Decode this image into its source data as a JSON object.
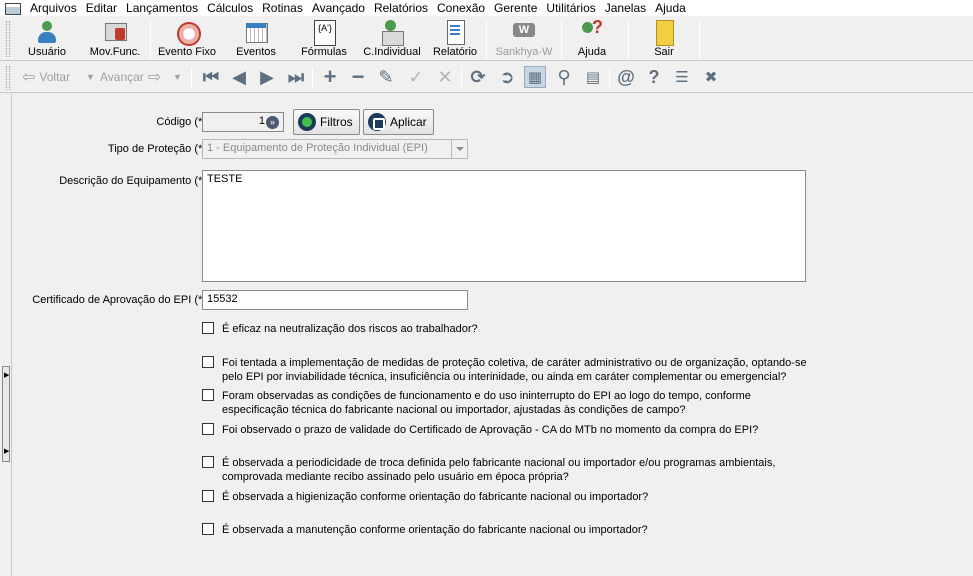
{
  "menu": {
    "items": [
      "Arquivos",
      "Editar",
      "Lançamentos",
      "Cálculos",
      "Rotinas",
      "Avançado",
      "Relatórios",
      "Conexão",
      "Gerente",
      "Utilitários",
      "Janelas",
      "Ajuda"
    ]
  },
  "toolbar": {
    "buttons": [
      {
        "label": "Usuário",
        "icon": "user-icon"
      },
      {
        "label": "Mov.Func.",
        "icon": "movement-icon"
      },
      {
        "label": "Evento Fixo",
        "icon": "fixed-event-icon"
      },
      {
        "label": "Eventos",
        "icon": "events-icon"
      },
      {
        "label": "Fórmulas",
        "icon": "formula-icon"
      },
      {
        "label": "C.Individual",
        "icon": "individual-icon"
      },
      {
        "label": "Relatório",
        "icon": "report-icon"
      },
      {
        "label": "Sankhya-W",
        "icon": "sankhya-icon"
      },
      {
        "label": "Ajuda",
        "icon": "help-icon"
      },
      {
        "label": "Sair",
        "icon": "exit-icon"
      }
    ]
  },
  "nav": {
    "back_label": "Voltar",
    "forward_label": "Avançar"
  },
  "form": {
    "code_label": "Código (*):",
    "code_value": "1",
    "filters_label": "Filtros",
    "apply_label": "Aplicar",
    "protection_type_label": "Tipo de Proteção (*):",
    "protection_type_value": "1 - Equipamento de Proteção Individual (EPI)",
    "description_label": "Descrição do Equipamento (*):",
    "description_value": "TESTE",
    "certificate_label": "Certificado de Aprovação do EPI (*):",
    "certificate_value": "15532",
    "checks": [
      {
        "line1": "É eficaz na neutralização dos riscos ao trabalhador?",
        "line2": ""
      },
      {
        "line1": "Foi tentada a implementação de medidas de proteção coletiva, de caráter administrativo ou de organização, optando-se",
        "line2": "pelo EPI por inviabilidade técnica, insuficiência ou interinidade, ou ainda em caráter complementar ou emergencial?"
      },
      {
        "line1": "Foram observadas as condições de funcionamento e do uso ininterrupto do EPI ao logo do tempo, conforme",
        "line2": "especificação técnica do fabricante nacional ou importador, ajustadas às condições de campo?"
      },
      {
        "line1": "Foi observado o prazo de validade do Certificado de Aprovação - CA do MTb no momento da compra do EPI?",
        "line2": ""
      },
      {
        "line1": "É observada a periodicidade de troca definida pelo fabricante nacional ou importador e/ou programas ambientais,",
        "line2": "comprovada mediante recibo assinado pelo usuário em época própria?"
      },
      {
        "line1": "É observada a higienização conforme orientação do fabricante nacional ou importador?",
        "line2": ""
      },
      {
        "line1": "É observada a manutenção conforme orientação do fabricante nacional ou importador?",
        "line2": ""
      }
    ]
  }
}
